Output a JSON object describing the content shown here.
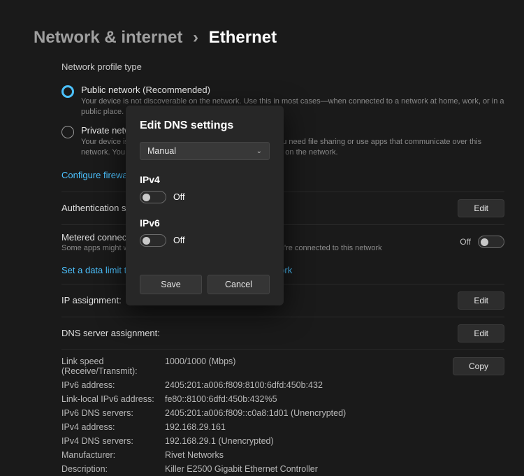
{
  "breadcrumb": {
    "parent": "Network & internet",
    "current": "Ethernet"
  },
  "profile": {
    "section_label": "Network profile type",
    "public_title": "Public network (Recommended)",
    "public_desc": "Your device is not discoverable on the network. Use this in most cases—when connected to a network at home, work, or in a public place.",
    "private_title": "Private network",
    "private_desc": "Your device is discoverable on the network. Select this if you need file sharing or use apps that communicate over this network. You should know and trust the people and devices on the network.",
    "firewall_link": "Configure firewall and security settings"
  },
  "rows": {
    "auth_label": "Authentication settings",
    "metered_label": "Metered connection",
    "metered_desc": "Some apps might work differently to reduce data usage when you're connected to this network",
    "metered_off": "Off",
    "data_limit_link": "Set a data limit to help control data usage on this network",
    "ip_label": "IP assignment:",
    "dns_label": "DNS server assignment:",
    "edit": "Edit",
    "copy": "Copy"
  },
  "props": {
    "link_speed_k": "Link speed (Receive/Transmit):",
    "link_speed_v": "1000/1000 (Mbps)",
    "ipv6_addr_k": "IPv6 address:",
    "ipv6_addr_v": "2405:201:a006:f809:8100:6dfd:450b:432",
    "linklocal_k": "Link-local IPv6 address:",
    "linklocal_v": "fe80::8100:6dfd:450b:432%5",
    "ipv6_dns_k": "IPv6 DNS servers:",
    "ipv6_dns_v": "2405:201:a006:f809::c0a8:1d01 (Unencrypted)",
    "ipv4_addr_k": "IPv4 address:",
    "ipv4_addr_v": "192.168.29.161",
    "ipv4_dns_k": "IPv4 DNS servers:",
    "ipv4_dns_v": "192.168.29.1 (Unencrypted)",
    "mfr_k": "Manufacturer:",
    "mfr_v": "Rivet Networks",
    "desc_k": "Description:",
    "desc_v": "Killer E2500 Gigabit Ethernet Controller"
  },
  "dialog": {
    "title": "Edit DNS settings",
    "mode": "Manual",
    "ipv4_label": "IPv4",
    "ipv4_state": "Off",
    "ipv6_label": "IPv6",
    "ipv6_state": "Off",
    "save": "Save",
    "cancel": "Cancel"
  }
}
